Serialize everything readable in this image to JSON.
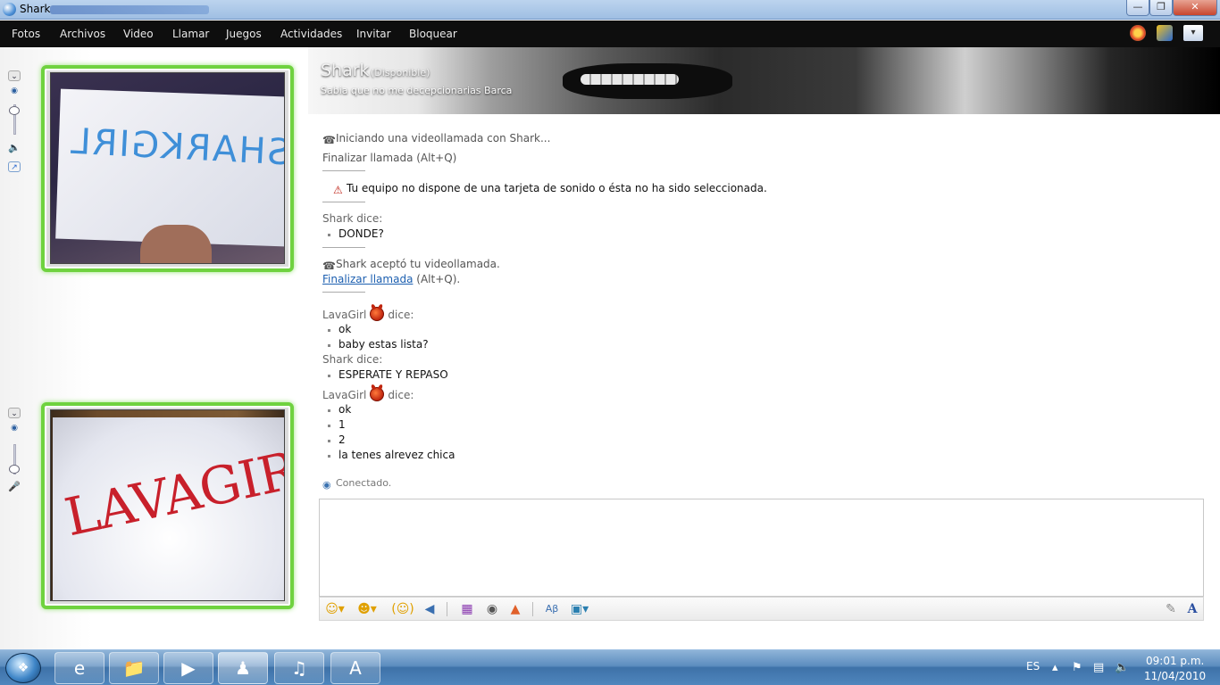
{
  "window": {
    "title": "Shark"
  },
  "menu": [
    "Fotos",
    "Archivos",
    "Video",
    "Llamar",
    "Juegos",
    "Actividades",
    "Invitar",
    "Bloquear"
  ],
  "header": {
    "contact_name": "Shark",
    "contact_status": "(Disponible)",
    "personal_message": "Sabia que no me decepcionarias Barca"
  },
  "webcams": {
    "remote_sign": "SHARKGIRL",
    "local_sign": "LAVAGIRL"
  },
  "conversation": {
    "call_start": "Iniciando una videollamada con Shark...",
    "end_call_hint": "Finalizar llamada (Alt+Q)",
    "sound_warning": "Tu equipo no dispone de una tarjeta de sonido o ésta no ha sido seleccionada.",
    "shark_says_1": "Shark dice:",
    "msg_donde": "DONDE?",
    "call_accepted": "Shark aceptó tu videollamada.",
    "end_call_link": "Finalizar llamada",
    "end_call_shortcut": "(Alt+Q).",
    "lava_name": "LavaGirl",
    "dice": "dice:",
    "msg_ok_1": "ok",
    "msg_baby": "baby estas lista?",
    "shark_says_2": "Shark dice:",
    "msg_esperate": "ESPERATE Y REPASO",
    "msg_ok_2": "ok",
    "msg_1": "1",
    "msg_2": "2",
    "msg_alrevez": "la tenes alrevez chica",
    "connected": "Conectado."
  },
  "taskbar": {
    "language": "ES",
    "time": "09:01 p.m.",
    "date": "11/04/2010"
  },
  "colors": {
    "menubar": "#0e0e0e",
    "webcam_border": "#6fd23f",
    "link": "#1c5fb0",
    "taskbar": "#4f86bd"
  }
}
